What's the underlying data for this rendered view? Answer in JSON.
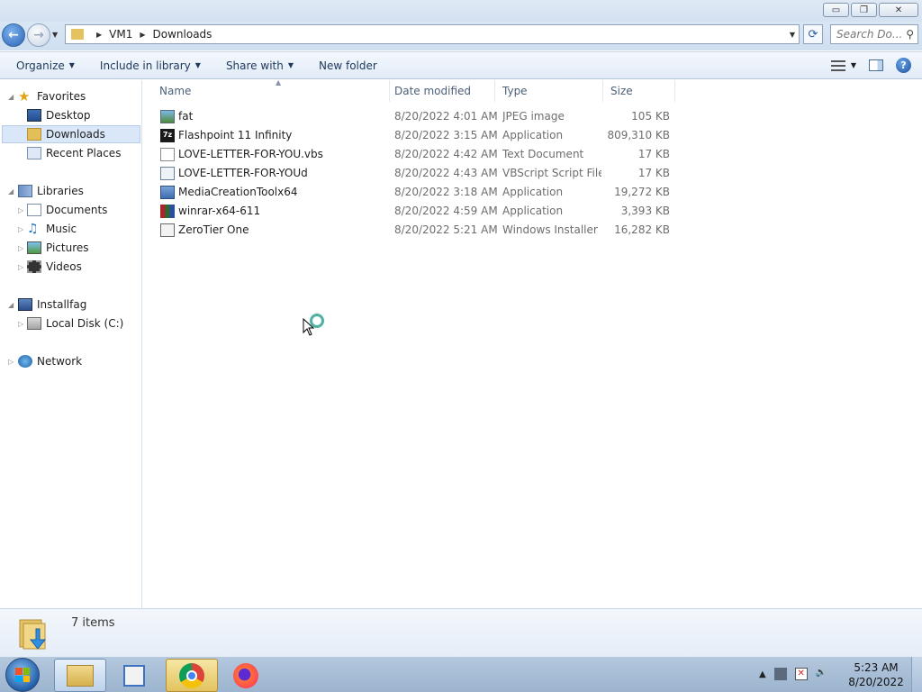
{
  "window": {
    "caption_buttons": {
      "minimize": "▭",
      "maximize": "❐",
      "close": "✕"
    }
  },
  "address_bar": {
    "breadcrumbs": [
      "VM1",
      "Downloads"
    ],
    "search_placeholder": "Search Do..."
  },
  "command_bar": {
    "organize": "Organize",
    "include_in_library": "Include in library",
    "share_with": "Share with",
    "new_folder": "New folder"
  },
  "sidebar": {
    "favorites": "Favorites",
    "desktop": "Desktop",
    "downloads": "Downloads",
    "recent_places": "Recent Places",
    "libraries": "Libraries",
    "documents": "Documents",
    "music": "Music",
    "pictures": "Pictures",
    "videos": "Videos",
    "computer": "Installfag",
    "local_disk": "Local Disk (C:)",
    "network": "Network"
  },
  "columns": {
    "name": "Name",
    "date_modified": "Date modified",
    "type": "Type",
    "size": "Size"
  },
  "files": [
    {
      "name": "fat",
      "date": "8/20/2022 4:01 AM",
      "type": "JPEG image",
      "size": "105 KB",
      "icon": "jpeg-icon"
    },
    {
      "name": "Flashpoint 11 Infinity",
      "date": "8/20/2022 3:15 AM",
      "type": "Application",
      "size": "809,310 KB",
      "icon": "7zip-icon"
    },
    {
      "name": "LOVE-LETTER-FOR-YOU.vbs",
      "date": "8/20/2022 4:42 AM",
      "type": "Text Document",
      "size": "17 KB",
      "icon": "text-document-icon"
    },
    {
      "name": "LOVE-LETTER-FOR-YOUd",
      "date": "8/20/2022 4:43 AM",
      "type": "VBScript Script File",
      "size": "17 KB",
      "icon": "vbscript-icon"
    },
    {
      "name": "MediaCreationToolx64",
      "date": "8/20/2022 3:18 AM",
      "type": "Application",
      "size": "19,272 KB",
      "icon": "application-icon"
    },
    {
      "name": "winrar-x64-611",
      "date": "8/20/2022 4:59 AM",
      "type": "Application",
      "size": "3,393 KB",
      "icon": "winrar-icon"
    },
    {
      "name": "ZeroTier One",
      "date": "8/20/2022 5:21 AM",
      "type": "Windows Installer ...",
      "size": "16,282 KB",
      "icon": "installer-icon"
    }
  ],
  "details": {
    "item_count": "7 items"
  },
  "taskbar": {
    "clock_time": "5:23 AM",
    "clock_date": "8/20/2022"
  }
}
